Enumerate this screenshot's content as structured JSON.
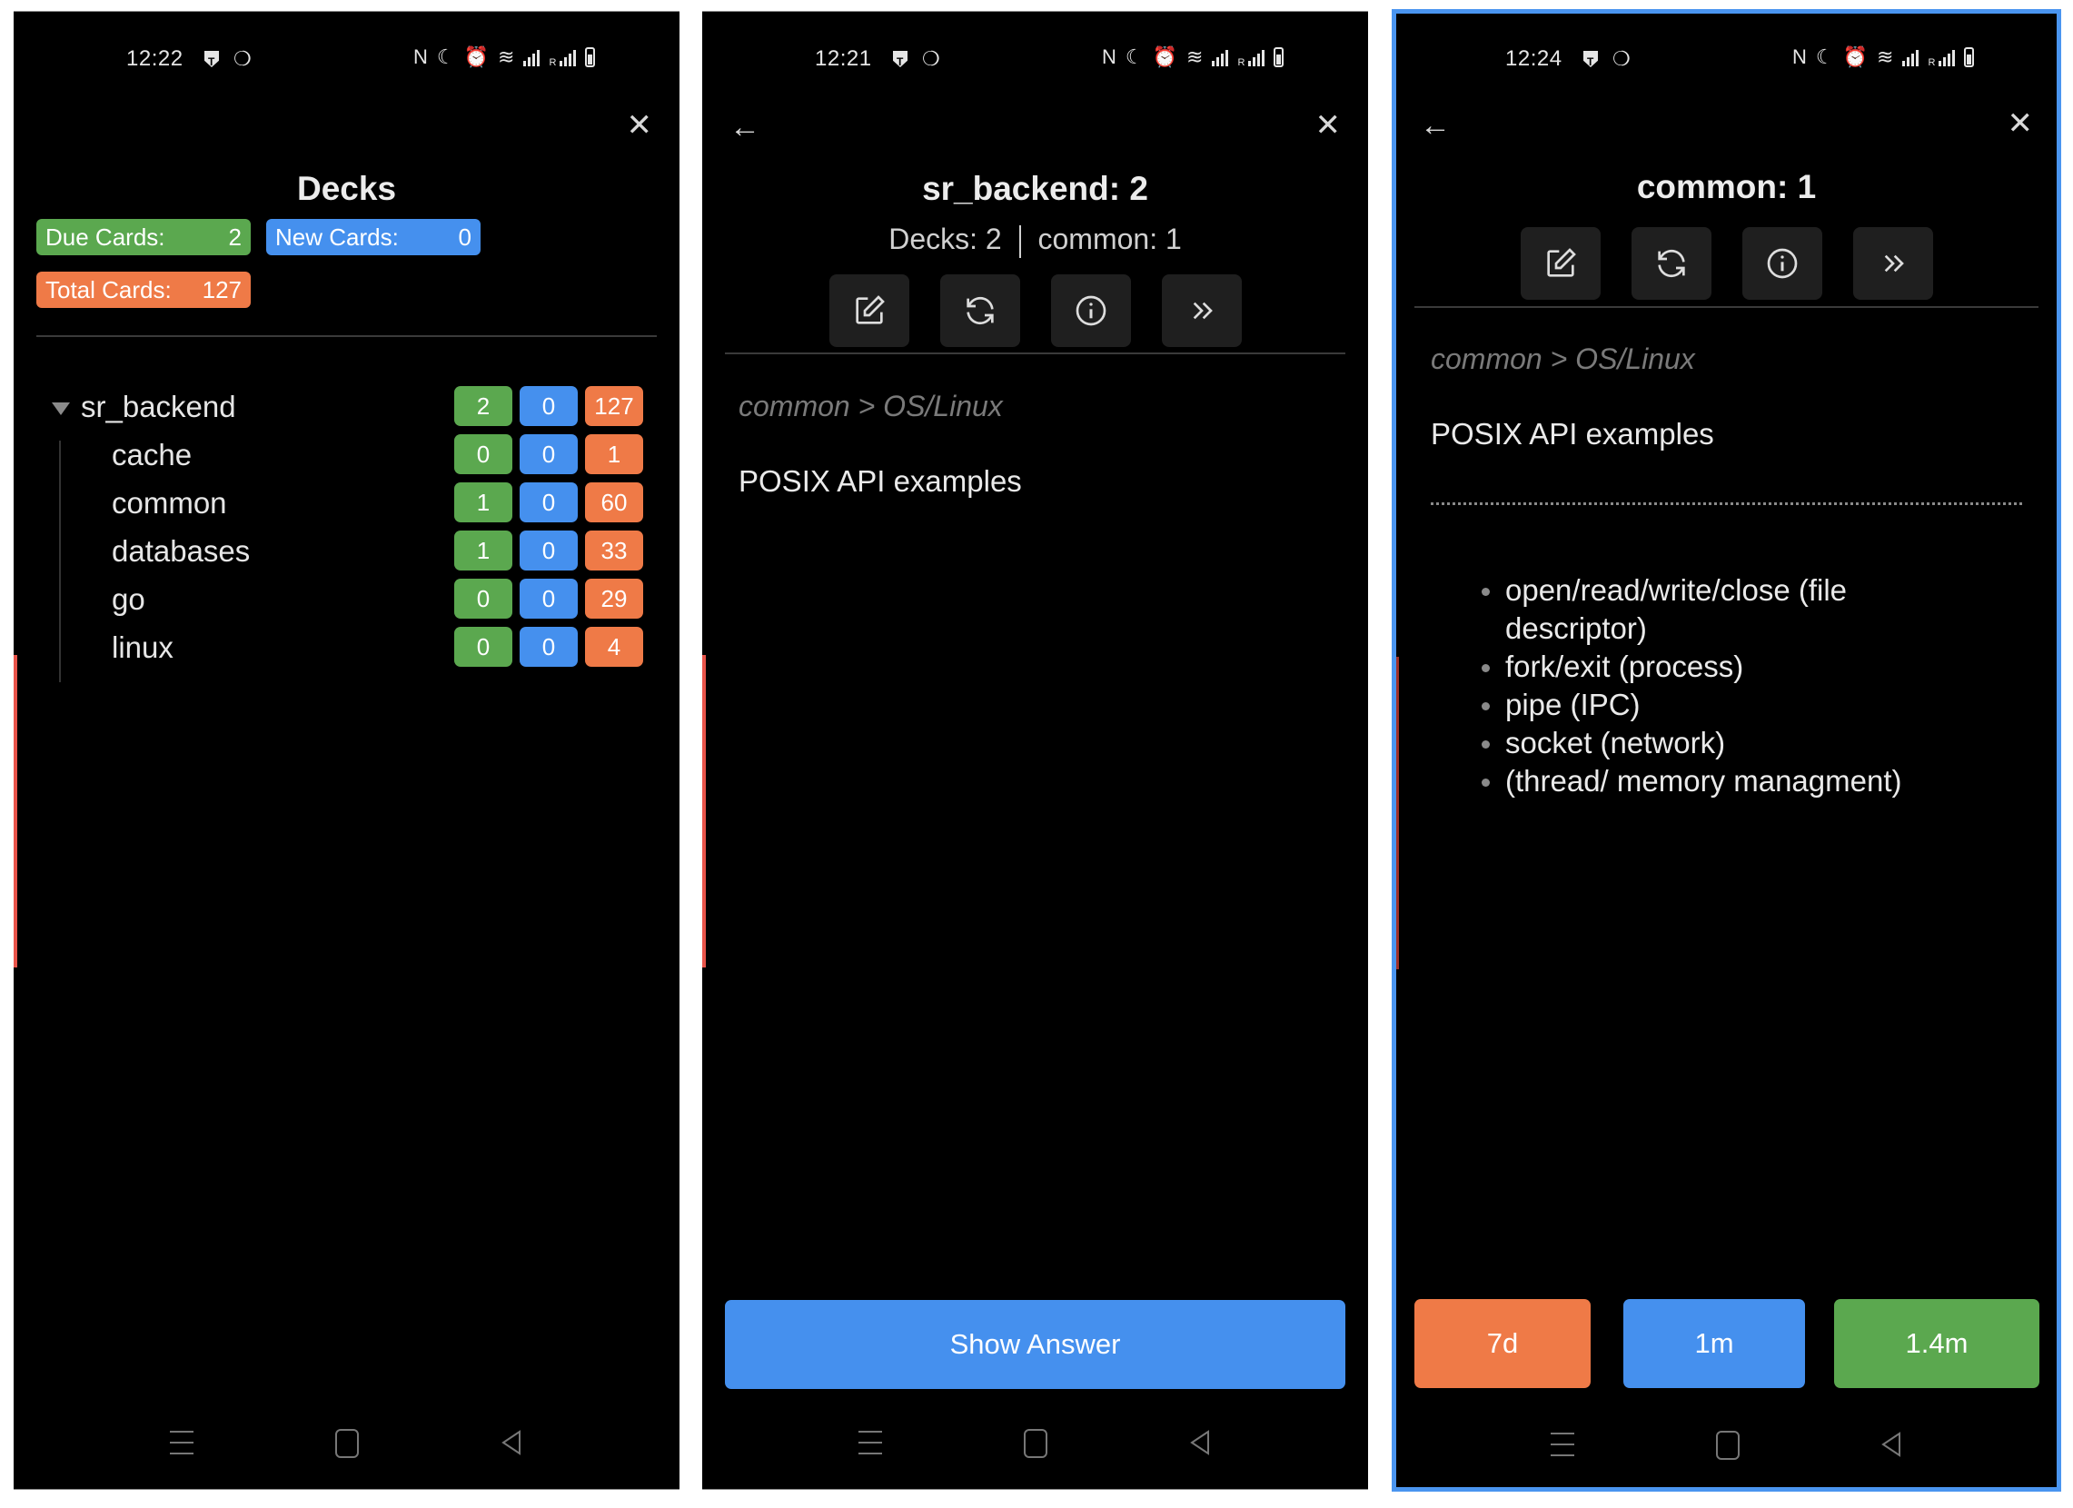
{
  "colors": {
    "due": "#5ba84f",
    "new": "#4590ee",
    "total": "#ef7a47",
    "selection_border": "#4a95f0"
  },
  "screens": [
    {
      "status_bar": {
        "time": "12:22",
        "left_icons": [
          "shield-t-icon",
          "leaf-icon"
        ],
        "right_icons": [
          "nfc-icon",
          "moon-icon",
          "alarm-icon",
          "wifi-icon",
          "signal-icon",
          "roaming-signal-icon",
          "battery-icon"
        ],
        "roaming_label": "R"
      },
      "close_icon": "✕",
      "title": "Decks",
      "stats": {
        "due_label": "Due Cards:",
        "due_value": "2",
        "new_label": "New Cards:",
        "new_value": "0",
        "total_label": "Total Cards:",
        "total_value": "127"
      },
      "deck_tree": [
        {
          "name": "sr_backend",
          "due": "2",
          "new": "0",
          "total": "127",
          "expanded": true,
          "level": 0
        },
        {
          "name": "cache",
          "due": "0",
          "new": "0",
          "total": "1",
          "level": 1
        },
        {
          "name": "common",
          "due": "1",
          "new": "0",
          "total": "60",
          "level": 1
        },
        {
          "name": "databases",
          "due": "1",
          "new": "0",
          "total": "33",
          "level": 1
        },
        {
          "name": "go",
          "due": "0",
          "new": "0",
          "total": "29",
          "level": 1
        },
        {
          "name": "linux",
          "due": "0",
          "new": "0",
          "total": "4",
          "level": 1
        }
      ]
    },
    {
      "status_bar": {
        "time": "12:21",
        "roaming_label": "R"
      },
      "back_icon": "←",
      "close_icon": "✕",
      "title": "sr_backend: 2",
      "subtitle_left": "Decks: 2",
      "subtitle_right": "common: 1",
      "actions": [
        "edit-icon",
        "refresh-icon",
        "info-icon",
        "skip-icon"
      ],
      "breadcrumb": "common > OS/Linux",
      "question": "POSIX API examples",
      "show_answer_label": "Show Answer"
    },
    {
      "status_bar": {
        "time": "12:24",
        "roaming_label": "R"
      },
      "back_icon": "←",
      "close_icon": "✕",
      "title": "common: 1",
      "actions": [
        "edit-icon",
        "refresh-icon",
        "info-icon",
        "skip-icon"
      ],
      "breadcrumb": "common > OS/Linux",
      "question": "POSIX API examples",
      "answer_items": [
        "open/read/write/close (file descriptor)",
        "fork/exit (process)",
        "pipe (IPC)",
        "socket (network)",
        "(thread/ memory managment)"
      ],
      "response_buttons": [
        {
          "label": "7d",
          "color": "#ef7a47"
        },
        {
          "label": "1m",
          "color": "#4590ee"
        },
        {
          "label": "1.4m",
          "color": "#5ba84f"
        }
      ]
    }
  ]
}
